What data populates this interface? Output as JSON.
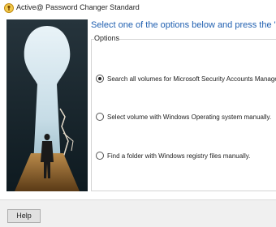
{
  "window": {
    "title": "Active@ Password Changer Standard",
    "icon": "password-changer-app-icon"
  },
  "main": {
    "heading": "Select one of the options below and press the \"Next\" to c",
    "heading_color": "#1f5fb0",
    "options_group_label": "Options",
    "options": [
      {
        "label": "Search all volumes for Microsoft Security Accounts Manage",
        "checked": true
      },
      {
        "label": "Select volume with Windows Operating system manually.",
        "checked": false
      },
      {
        "label": "Find a folder with Windows registry files manually.",
        "checked": false
      }
    ]
  },
  "footer": {
    "help_label": "Help"
  }
}
